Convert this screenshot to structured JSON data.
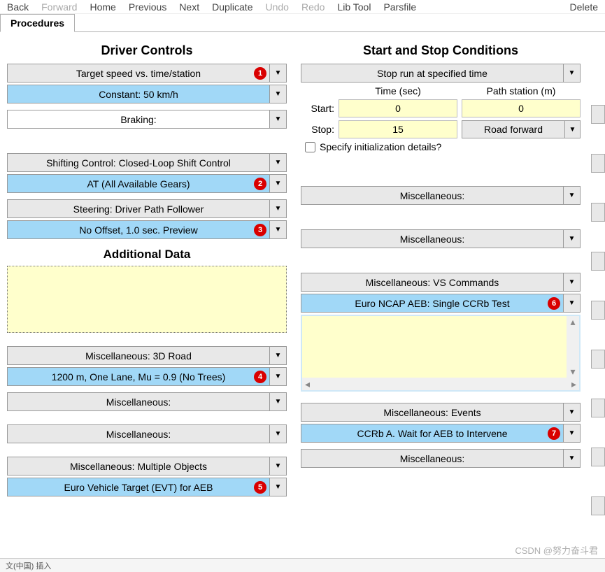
{
  "toolbar": {
    "back": "Back",
    "fwd": "Forward",
    "home": "Home",
    "prev": "Previous",
    "next": "Next",
    "dup": "Duplicate",
    "undo": "Undo",
    "redo": "Redo",
    "lib": "Lib Tool",
    "pars": "Parsfile",
    "del": "Delete"
  },
  "tab": {
    "procedures": "Procedures"
  },
  "left": {
    "title": "Driver Controls",
    "target_speed": "Target speed vs. time/station",
    "constant": "Constant: 50 km/h",
    "braking": "Braking:",
    "shift_ctrl": "Shifting Control: Closed-Loop Shift Control",
    "at_gears": "AT (All Available Gears)",
    "steering": "Steering: Driver Path Follower",
    "offset": "No Offset, 1.0 sec. Preview",
    "add_title": "Additional Data",
    "misc_3d": "Miscellaneous: 3D Road",
    "road_1200": "1200 m, One Lane, Mu = 0.9 (No Trees)",
    "misc_a": "Miscellaneous:",
    "misc_b": "Miscellaneous:",
    "misc_multi": "Miscellaneous: Multiple Objects",
    "evt": "Euro Vehicle Target (EVT) for AEB"
  },
  "right": {
    "title": "Start and Stop Conditions",
    "stop_run": "Stop run at specified time",
    "time_hdr": "Time (sec)",
    "path_hdr": "Path station (m)",
    "start_lbl": "Start:",
    "stop_lbl": "Stop:",
    "start_time": "0",
    "start_path": "0",
    "stop_time": "15",
    "road_fwd": "Road forward",
    "specify": "Specify initialization details?",
    "misc_1": "Miscellaneous:",
    "misc_2": "Miscellaneous:",
    "misc_vs": "Miscellaneous: VS Commands",
    "ncap": "Euro NCAP AEB: Single CCRb Test",
    "misc_ev": "Miscellaneous: Events",
    "ccrb": "CCRb A. Wait for AEB to Intervene",
    "misc_last": "Miscellaneous:"
  },
  "badges": {
    "b1": "1",
    "b2": "2",
    "b3": "3",
    "b4": "4",
    "b5": "5",
    "b6": "6",
    "b7": "7"
  },
  "watermark": "CSDN @努力奋斗君",
  "status": "文(中国) 插入"
}
